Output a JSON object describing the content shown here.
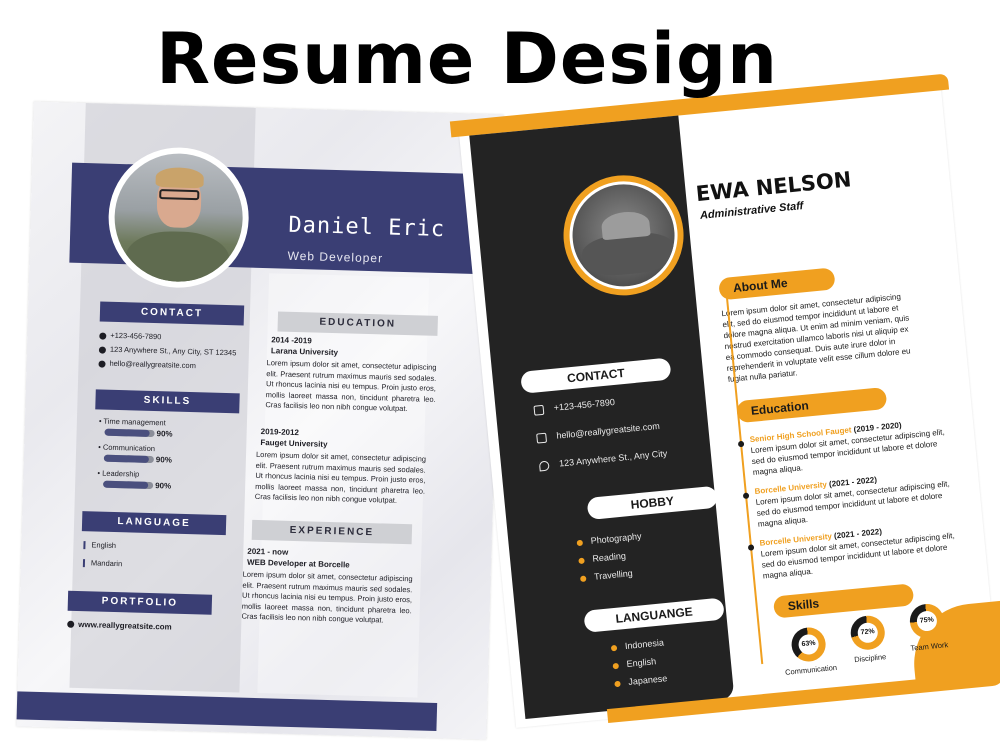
{
  "page_title": "Resume Design",
  "resume1": {
    "name": "Daniel Eric",
    "role": "Web Developer",
    "contact_header": "CONTACT",
    "contact": [
      {
        "icon": "phone-icon",
        "text": "+123-456-7890"
      },
      {
        "icon": "location-icon",
        "text": "123 Anywhere St., Any City, ST 12345"
      },
      {
        "icon": "email-icon",
        "text": "hello@reallygreatsite.com"
      }
    ],
    "skills_header": "SKILLS",
    "skills": [
      {
        "name": "Time management",
        "percent_label": "90%",
        "level": 90
      },
      {
        "name": "Communication",
        "percent_label": "90%",
        "level": 90
      },
      {
        "name": "Leadership",
        "percent_label": "90%",
        "level": 90
      }
    ],
    "language_header": "LANGUAGE",
    "languages": [
      "English",
      "Mandarin"
    ],
    "portfolio_header": "PORTFOLIO",
    "portfolio_url": "www.reallygreatsite.com",
    "education_header": "EDUCATION",
    "education": [
      {
        "years": "2014 -2019",
        "school": "Larana University",
        "text": "Lorem ipsum dolor sit amet, consectetur adipiscing elit. Praesent rutrum maximus mauris sed sodales. Ut rhoncus lacinia nisi eu tempus. Proin justo eros, mollis laoreet massa non, tincidunt pharetra leo. Cras facilisis leo non nibh congue volutpat."
      },
      {
        "years": "2019-2012",
        "school": "Fauget University",
        "text": "Lorem ipsum dolor sit amet, consectetur adipiscing elit. Praesent rutrum maximus mauris sed sodales. Ut rhoncus lacinia nisi eu tempus. Proin justo eros, mollis laoreet massa non, tincidunt pharetra leo. Cras facilisis leo non nibh congue volutpat."
      }
    ],
    "experience_header": "EXPERIENCE",
    "experience": [
      {
        "years": "2021 - now",
        "title": "WEB Developer at Borcelle",
        "text": "Lorem ipsum dolor sit amet, consectetur adipiscing elit. Praesent rutrum maximus mauris sed sodales. Ut rhoncus lacinia nisi eu tempus. Proin justo eros, mollis laoreet massa non, tincidunt pharetra leo. Cras facilisis leo non nibh congue volutpat."
      }
    ],
    "colors": {
      "navy": "#3a3e74",
      "grey": "#cfd0d4"
    }
  },
  "resume2": {
    "name": "EWA NELSON",
    "role": "Administrative Staff",
    "about_header": "About Me",
    "about_text": "Lorem ipsum dolor sit amet, consectetur adipiscing elit, sed do eiusmod tempor incididunt ut labore et dolore magna aliqua. Ut enim ad minim veniam, quis nostrud exercitation ullamco laboris nisi ut aliquip ex ea commodo consequat. Duis aute irure dolor in reprehenderit in voluptate velit esse cillum dolore eu fugiat nulla pariatur.",
    "contact_header": "CONTACT",
    "contact": [
      {
        "icon": "phone-icon",
        "text": "+123-456-7890"
      },
      {
        "icon": "email-icon",
        "text": "hello@reallygreatsite.com"
      },
      {
        "icon": "location-icon",
        "text": "123 Anywhere St., Any City"
      }
    ],
    "hobby_header": "HOBBY",
    "hobbies": [
      "Photography",
      "Reading",
      "Travelling"
    ],
    "language_header": "LANGUANGE",
    "languages": [
      "Indonesia",
      "English",
      "Japanese"
    ],
    "education_header": "Education",
    "education": [
      {
        "school": "Senior High School Fauget",
        "years": "(2019 - 2020)",
        "text": "Lorem ipsum dolor sit amet, consectetur adipiscing elit, sed do eiusmod tempor incididunt ut labore et dolore magna aliqua."
      },
      {
        "school": "Borcelle  University",
        "years": "(2021 - 2022)",
        "text": "Lorem ipsum dolor sit amet, consectetur adipiscing elit, sed do eiusmod tempor incididunt ut labore et dolore magna aliqua."
      },
      {
        "school": "Borcelle  University",
        "years": "(2021 - 2022)",
        "text": "Lorem ipsum dolor sit amet, consectetur adipiscing elit, sed do eiusmod tempor incididunt ut labore et dolore magna aliqua."
      }
    ],
    "skills_header": "Skills",
    "skills": [
      {
        "label": "63%",
        "name": "Communication",
        "level": 63
      },
      {
        "label": "72%",
        "name": "Discipline",
        "level": 72
      },
      {
        "label": "75%",
        "name": "Team Work",
        "level": 75
      }
    ],
    "colors": {
      "orange": "#f0a020",
      "dark": "#232323"
    }
  }
}
